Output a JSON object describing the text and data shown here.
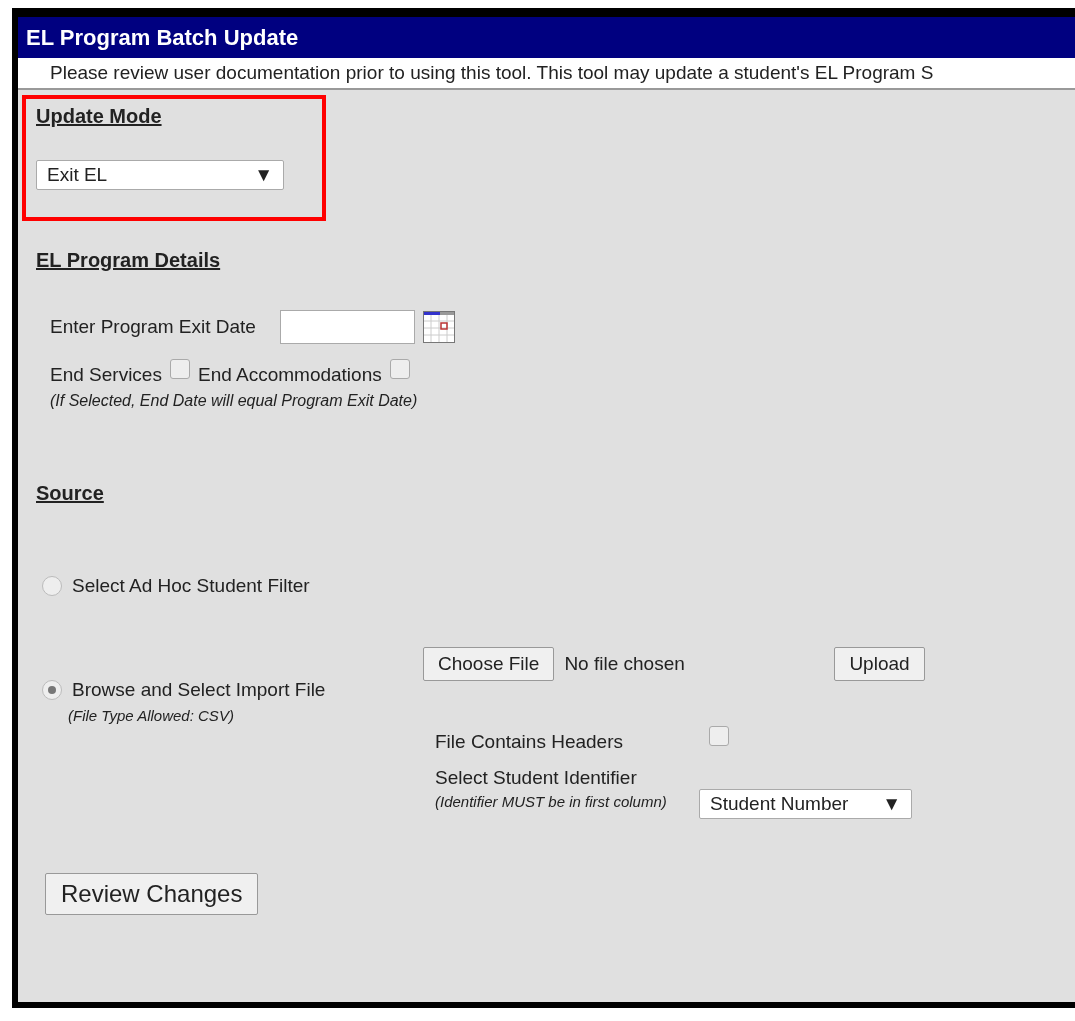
{
  "panel": {
    "title": "EL Program Batch Update",
    "notice": "Please review user documentation prior to using this tool. This tool may update a student's EL Program S"
  },
  "update_mode": {
    "heading": "Update Mode",
    "highlighted": true,
    "select": {
      "value": "Exit EL",
      "arrow": "▼"
    }
  },
  "details": {
    "heading": "EL Program Details",
    "exit_date": {
      "label": "Enter Program Exit Date"
    },
    "checkboxes": [
      {
        "label": "End Services",
        "checked": false
      },
      {
        "label": "End Accommodations",
        "checked": false
      }
    ],
    "note": "(If Selected, End Date will equal Program Exit Date)"
  },
  "source": {
    "heading": "Source",
    "options": [
      {
        "label": "Select Ad Hoc Student Filter",
        "selected": false
      },
      {
        "label": "Browse and Select Import File",
        "selected": true,
        "hint": "(File Type Allowed: CSV)"
      }
    ],
    "file": {
      "choose_button": "Choose File",
      "status": "No file chosen",
      "upload_button": "Upload"
    },
    "headers_checkbox": {
      "label": "File Contains Headers",
      "checked": false
    },
    "identifier": {
      "label": "Select Student Identifier",
      "hint": "(Identifier MUST be in first column)",
      "value": "Student Number",
      "arrow": "▼"
    }
  },
  "buttons": [
    "Review Changes"
  ]
}
